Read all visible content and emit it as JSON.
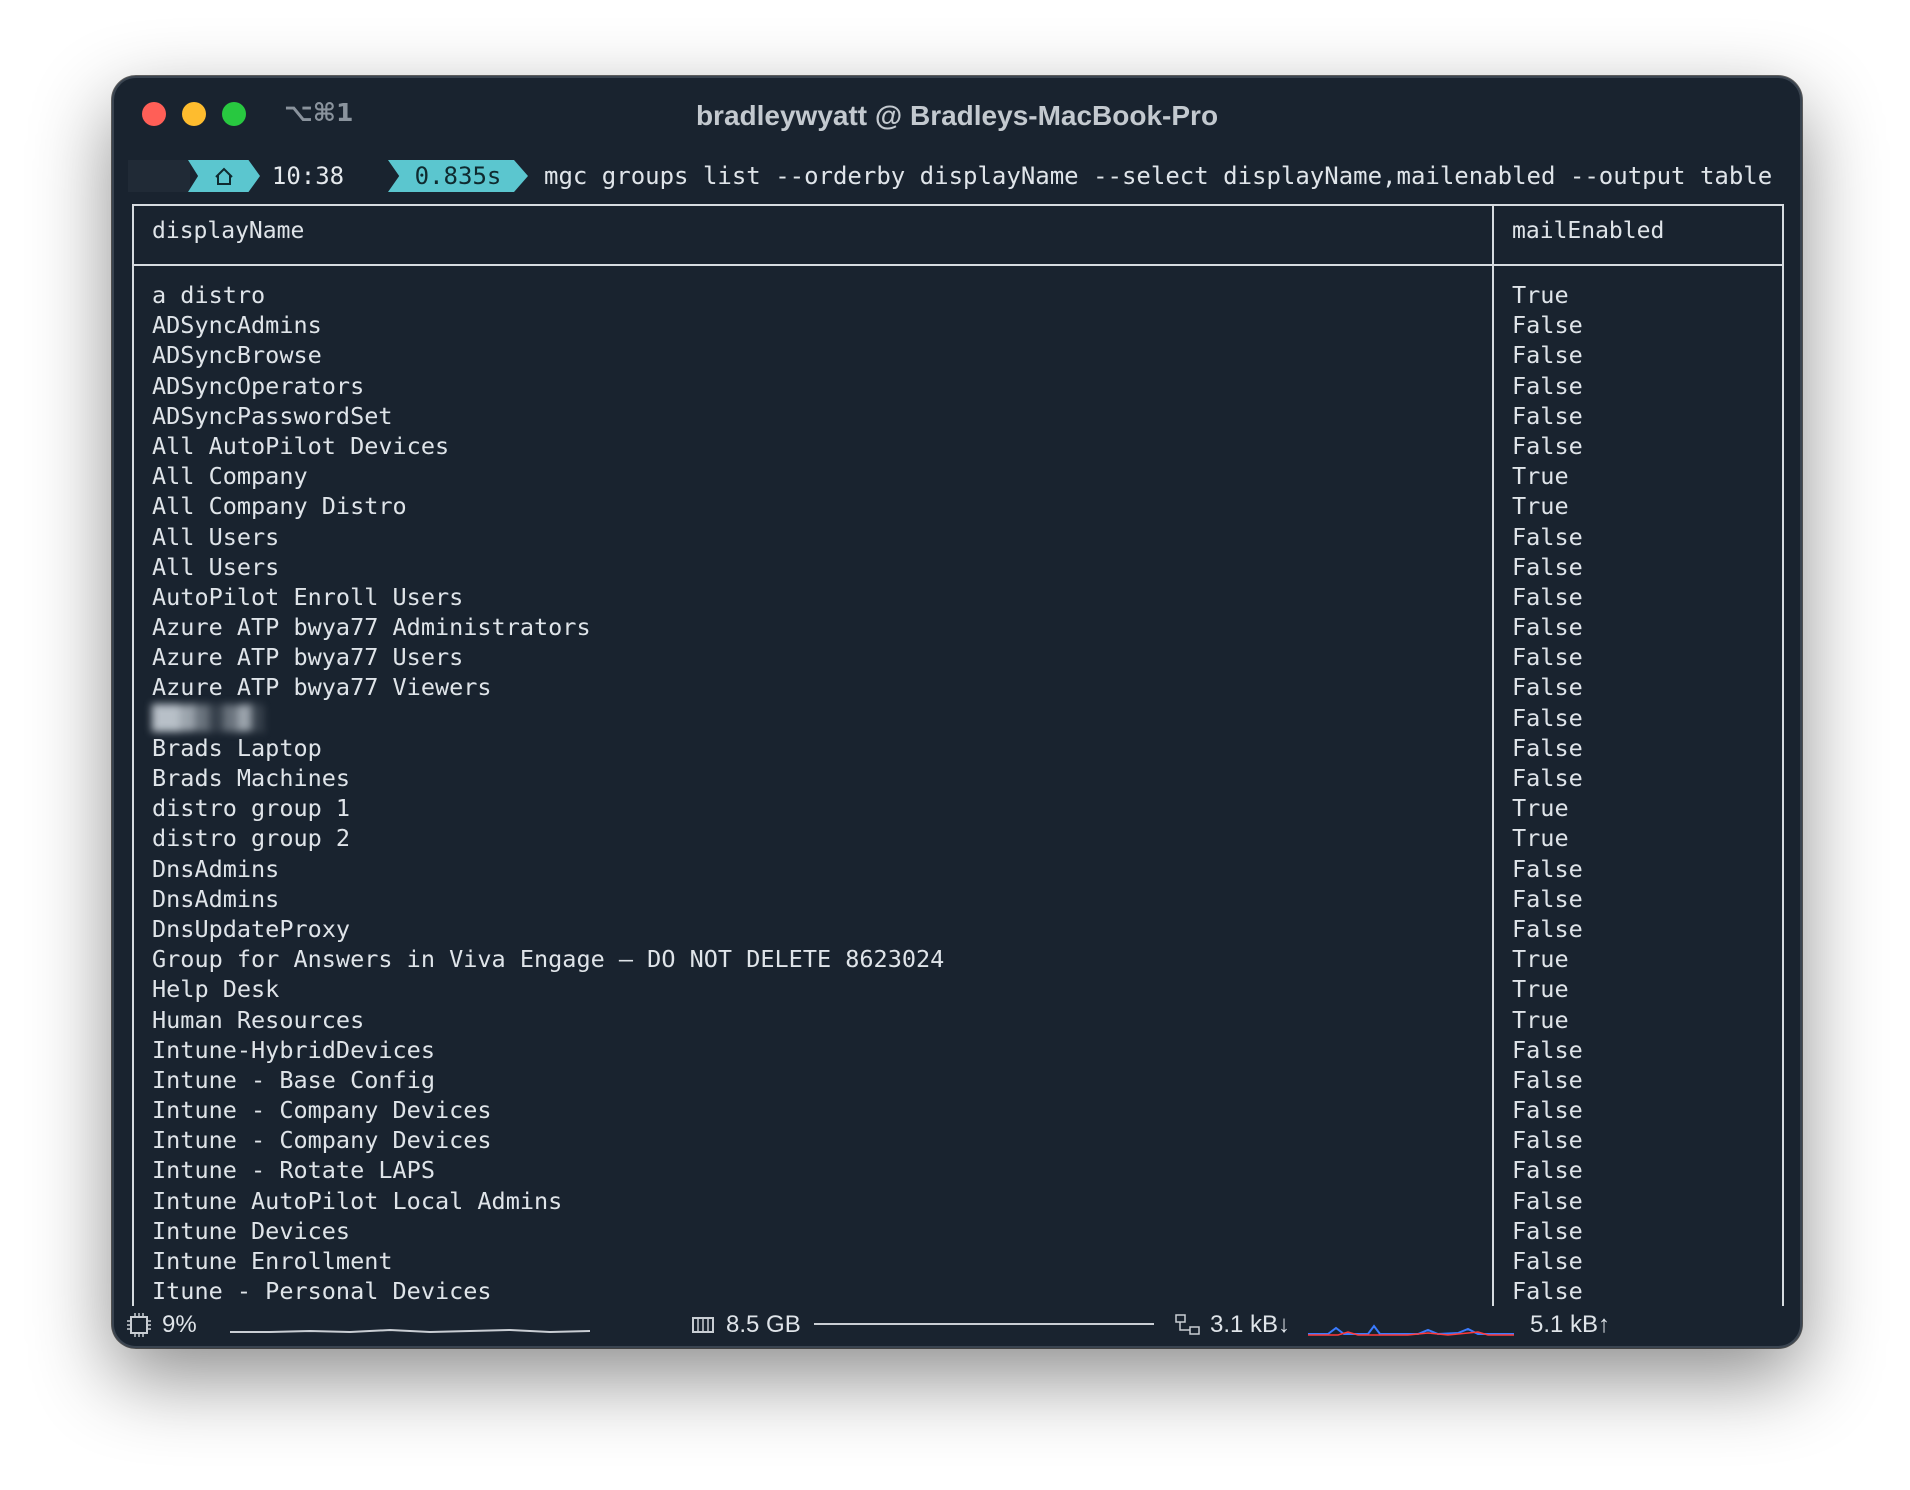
{
  "window": {
    "title": "bradleywyatt @ Bradleys-MacBook-Pro",
    "shortcut": "⌥⌘1"
  },
  "prompt": {
    "time": "10:38",
    "duration": "0.835s",
    "command": "mgc groups list --orderby displayName --select displayName,mailenabled --output table"
  },
  "table": {
    "headers": [
      "displayName",
      "mailEnabled"
    ],
    "rows": [
      [
        "a distro",
        "True"
      ],
      [
        "ADSyncAdmins",
        "False"
      ],
      [
        "ADSyncBrowse",
        "False"
      ],
      [
        "ADSyncOperators",
        "False"
      ],
      [
        "ADSyncPasswordSet",
        "False"
      ],
      [
        "All AutoPilot Devices",
        "False"
      ],
      [
        "All Company",
        "True"
      ],
      [
        "All Company Distro",
        "True"
      ],
      [
        "All Users",
        "False"
      ],
      [
        "All Users",
        "False"
      ],
      [
        "AutoPilot Enroll Users",
        "False"
      ],
      [
        "Azure ATP bwya77 Administrators",
        "False"
      ],
      [
        "Azure ATP bwya77 Users",
        "False"
      ],
      [
        "Azure ATP bwya77 Viewers",
        "False"
      ],
      [
        "",
        "False"
      ],
      [
        "Brads Laptop",
        "False"
      ],
      [
        "Brads Machines",
        "False"
      ],
      [
        "distro group 1",
        "True"
      ],
      [
        "distro group 2",
        "True"
      ],
      [
        "DnsAdmins",
        "False"
      ],
      [
        "DnsAdmins",
        "False"
      ],
      [
        "DnsUpdateProxy",
        "False"
      ],
      [
        "Group for Answers in Viva Engage — DO NOT DELETE 8623024",
        "True"
      ],
      [
        "Help Desk",
        "True"
      ],
      [
        "Human Resources",
        "True"
      ],
      [
        "Intune-HybridDevices",
        "False"
      ],
      [
        "Intune - Base Config",
        "False"
      ],
      [
        "Intune - Company Devices",
        "False"
      ],
      [
        "Intune - Company Devices",
        "False"
      ],
      [
        "Intune - Rotate LAPS",
        "False"
      ],
      [
        "Intune AutoPilot Local Admins",
        "False"
      ],
      [
        "Intune Devices",
        "False"
      ],
      [
        "Intune Enrollment",
        "False"
      ],
      [
        "Itune - Personal Devices",
        "False"
      ]
    ]
  },
  "status": {
    "cpu": "9%",
    "memory": "8.5 GB",
    "net_down": "3.1 kB↓",
    "net_up": "5.1 kB↑"
  },
  "icons": {
    "apple": "apple-icon",
    "home": "home-icon",
    "cpu": "cpu-icon",
    "memory": "memory-icon",
    "network": "network-icon"
  },
  "colors": {
    "background": "#19232f",
    "accent": "#5bc6cf",
    "text": "#dfe4e9"
  }
}
